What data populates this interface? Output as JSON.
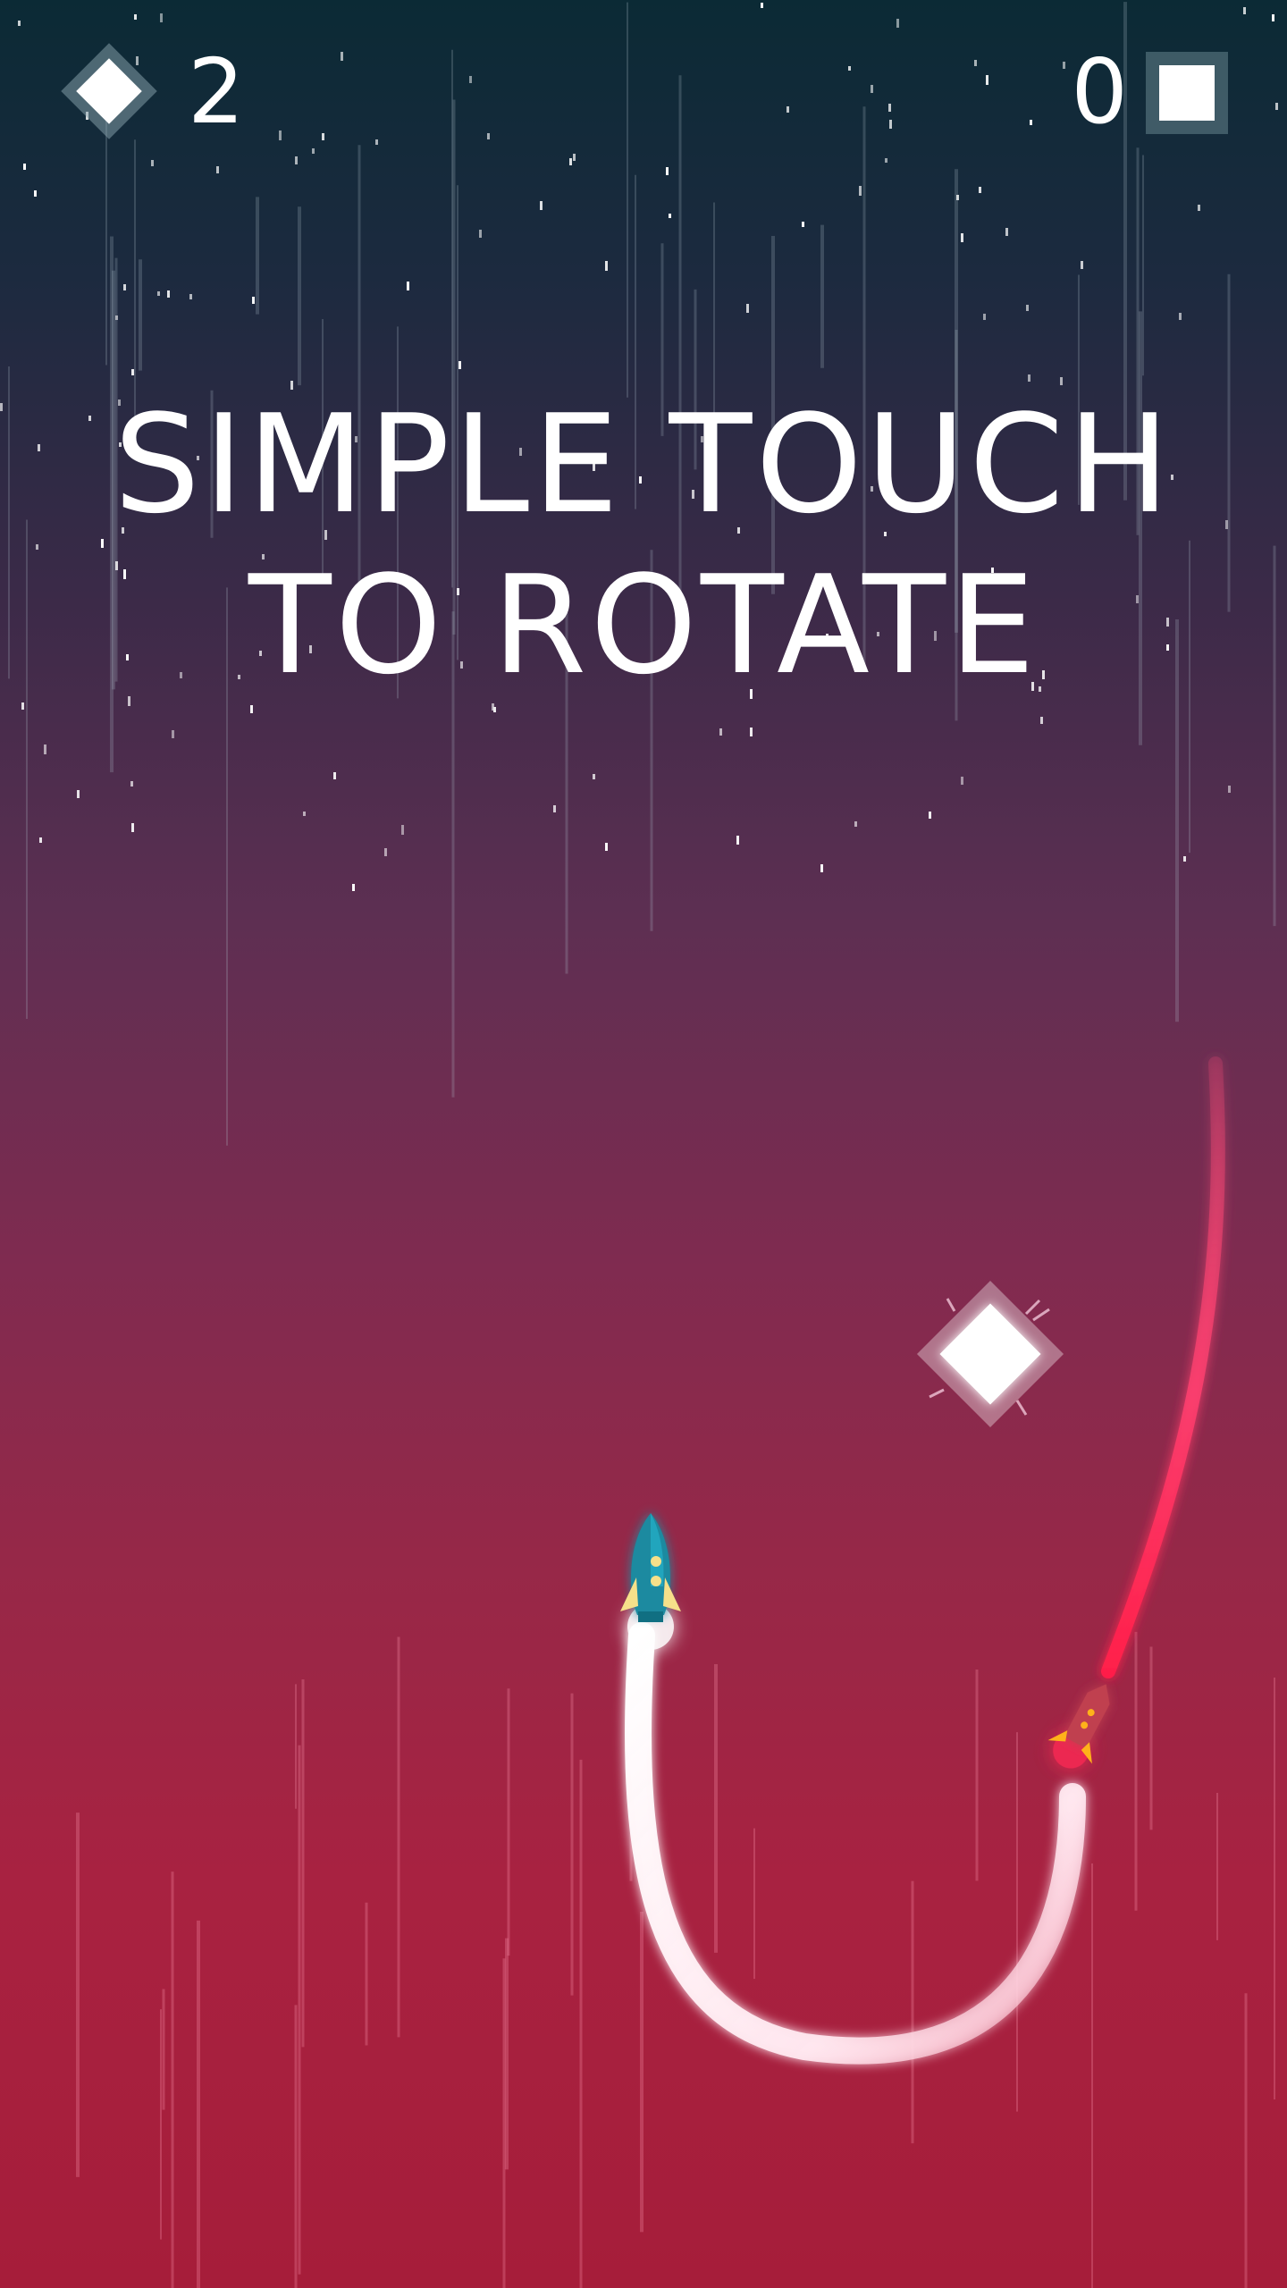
{
  "hud": {
    "gem_count": "2",
    "score": "0",
    "gem_icon": "diamond-icon",
    "pause_icon": "square-stop-icon"
  },
  "tutorial": {
    "line1": "SIMPLE TOUCH",
    "line2": "TO ROTATE"
  },
  "scene": {
    "player": "blue-rocket",
    "enemy": "red-missile",
    "pickup": "diamond-gem"
  },
  "colors": {
    "bg_top": "#0b2a35",
    "bg_bottom": "#a61d3a",
    "player_trail": "#ffffff",
    "enemy_trail": "#ff2a55",
    "rocket_body": "#1b8aa0",
    "rocket_fins": "#f6e08a"
  }
}
